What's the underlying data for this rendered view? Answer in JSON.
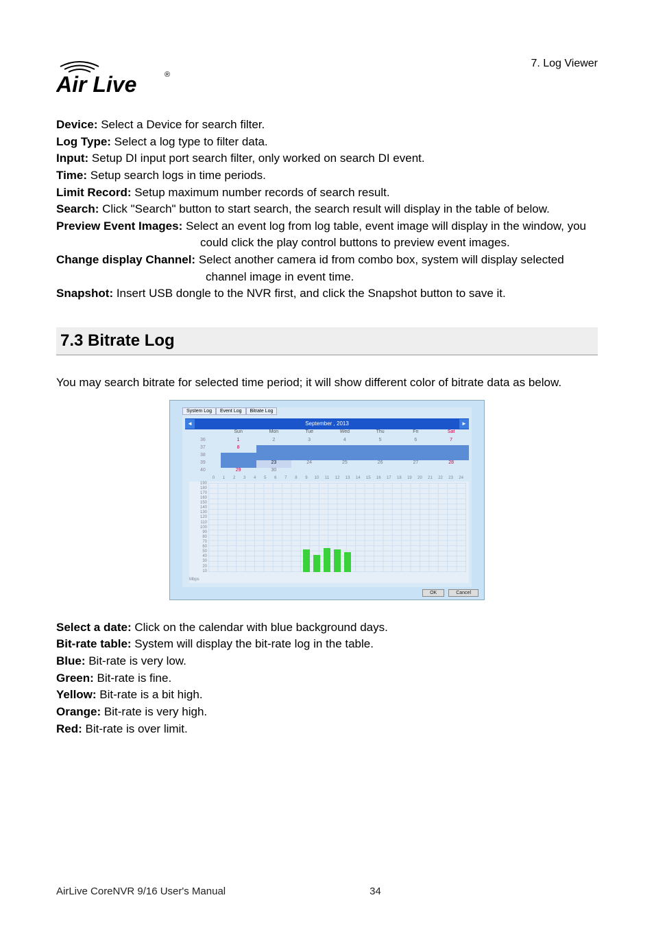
{
  "header": {
    "breadcrumb": "7. Log Viewer",
    "logo_text": "Air Live",
    "logo_reg": "®"
  },
  "defs": {
    "device": {
      "label": "Device:",
      "text": " Select a Device for search filter."
    },
    "logtype": {
      "label": "Log Type:",
      "text": " Select a log type to filter data."
    },
    "input": {
      "label": "Input:",
      "text": " Setup DI input port search filter, only worked on search DI event."
    },
    "time": {
      "label": "Time:",
      "text": " Setup search logs in time periods."
    },
    "limit": {
      "label": "Limit Record:",
      "text": " Setup maximum number records of search result."
    },
    "search": {
      "label": "Search:",
      "text": " Click \"Search\" button to start search, the search result will display in the table of below."
    },
    "preview": {
      "label": "Preview Event Images:",
      "text": " Select an event log from log table, event image will display in the window, you could click the play control buttons to preview event images."
    },
    "changech": {
      "label": "Change display Channel:",
      "text": " Select another camera id from combo box, system will display selected channel image in event time."
    },
    "snapshot": {
      "label": "Snapshot:",
      "text": " Insert USB dongle to the NVR first, and click the Snapshot button to save it."
    }
  },
  "section": {
    "num": "7.3",
    "title": "Bitrate Log",
    "intro": "You may search bitrate for selected time period; it will show different color of bitrate data as below."
  },
  "post_defs": {
    "selectdate": {
      "label": "Select a date:",
      "text": " Click on the calendar with blue background days."
    },
    "bitrate_table": {
      "label": "Bit-rate table:",
      "text": " System will display the bit-rate log in the table."
    },
    "blue": {
      "label": "Blue:",
      "text": " Bit-rate is very low."
    },
    "green": {
      "label": "Green:",
      "text": " Bit-rate is fine."
    },
    "yellow": {
      "label": "Yellow:",
      "text": " Bit-rate is a bit high."
    },
    "orange": {
      "label": "Orange:",
      "text": " Bit-rate is very high."
    },
    "red": {
      "label": "Red:",
      "text": " Bit-rate is over limit."
    }
  },
  "screenshot": {
    "tabs": [
      "System Log",
      "Event Log",
      "Bitrate Log"
    ],
    "calendar": {
      "title": "September , 2013",
      "dow": [
        "",
        "Sun",
        "Mon",
        "Tue",
        "Wed",
        "Thu",
        "Fri",
        "Sat"
      ],
      "rows": [
        {
          "wk": "36",
          "cells": [
            "1",
            "2",
            "3",
            "4",
            "5",
            "6",
            "7"
          ],
          "types": [
            "",
            "",
            "",
            "",
            "",
            "",
            ""
          ]
        },
        {
          "wk": "37",
          "cells": [
            "8",
            "",
            "",
            "",
            "",
            "",
            ""
          ],
          "types": [
            "",
            "blue",
            "blue",
            "blue",
            "blue",
            "blue",
            "blue"
          ]
        },
        {
          "wk": "38",
          "cells": [
            "",
            "",
            "",
            "",
            "",
            "",
            ""
          ],
          "types": [
            "blue",
            "blue",
            "blue",
            "blue",
            "blue",
            "blue",
            "blue"
          ]
        },
        {
          "wk": "39",
          "cells": [
            "",
            "23",
            "24",
            "25",
            "26",
            "27",
            "28"
          ],
          "types": [
            "blue",
            "sel",
            "",
            "",
            "",
            "",
            ""
          ]
        },
        {
          "wk": "40",
          "cells": [
            "29",
            "30",
            "",
            "",
            "",
            "",
            ""
          ],
          "types": [
            "",
            "",
            "",
            "",
            "",
            "",
            ""
          ]
        }
      ]
    },
    "buttons": {
      "ok": "OK",
      "cancel": "Cancel"
    }
  },
  "chart_data": {
    "type": "bar",
    "unit_label": "Mbps",
    "ylim": [
      0,
      190
    ],
    "yticks": [
      190,
      180,
      170,
      160,
      150,
      140,
      130,
      120,
      110,
      100,
      90,
      80,
      70,
      60,
      50,
      40,
      30,
      20,
      10
    ],
    "xlabels": [
      "0",
      "1",
      "2",
      "3",
      "4",
      "5",
      "6",
      "7",
      "8",
      "9",
      "10",
      "11",
      "12",
      "13",
      "14",
      "15",
      "16",
      "17",
      "18",
      "19",
      "20",
      "21",
      "22",
      "23",
      "24"
    ],
    "bars": [
      {
        "hour": 9,
        "value": 48,
        "color": "green"
      },
      {
        "hour": 10,
        "value": 36,
        "color": "green"
      },
      {
        "hour": 11,
        "value": 50,
        "color": "green"
      },
      {
        "hour": 12,
        "value": 48,
        "color": "green"
      },
      {
        "hour": 13,
        "value": 42,
        "color": "green"
      }
    ],
    "colors": {
      "green": "#3ad23a"
    }
  },
  "footer": {
    "manual": "AirLive CoreNVR 9/16 User's Manual",
    "page": "34"
  }
}
